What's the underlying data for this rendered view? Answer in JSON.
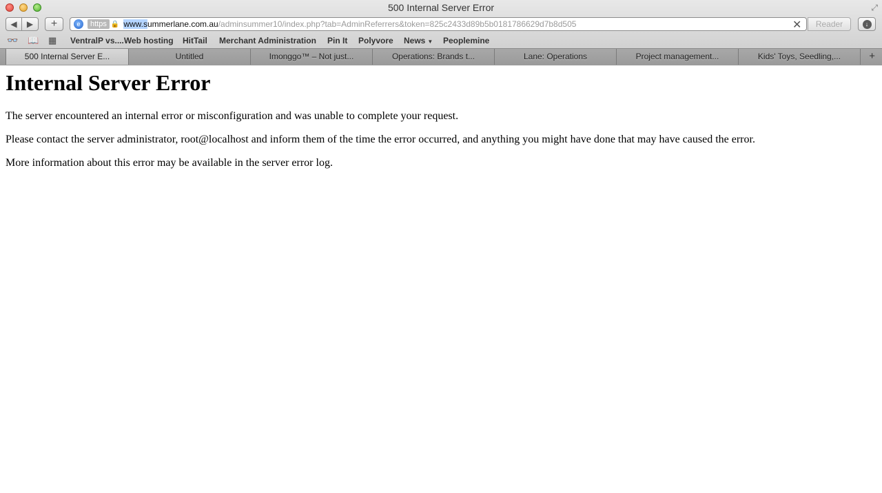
{
  "window": {
    "title": "500 Internal Server Error"
  },
  "toolbar": {
    "back_icon": "triangle-left-icon",
    "forward_icon": "triangle-right-icon",
    "new_tab_label": "+",
    "url": {
      "scheme_badge": "https",
      "host_selected": "www.s",
      "host_rest": "ummerlane.com.au",
      "path": "/adminsummer10/index.php?tab=AdminReferrers&token=825c2433d89b5b0181786629d7b8d505"
    },
    "reader_label": "Reader"
  },
  "bookmarks": {
    "items": [
      {
        "label": "VentralP vs....Web hosting"
      },
      {
        "label": "HitTail"
      },
      {
        "label": "Merchant Administration"
      },
      {
        "label": "Pin It"
      },
      {
        "label": "Polyvore"
      },
      {
        "label": "News"
      },
      {
        "label": "Peoplemine"
      }
    ]
  },
  "tabs": [
    {
      "label": "500 Internal Server E..."
    },
    {
      "label": "Untitled"
    },
    {
      "label": "Imonggo™ – Not just..."
    },
    {
      "label": "Operations: Brands t..."
    },
    {
      "label": "Lane: Operations"
    },
    {
      "label": "Project management..."
    },
    {
      "label": "Kids' Toys, Seedling,..."
    }
  ],
  "page": {
    "heading": "Internal Server Error",
    "p1": "The server encountered an internal error or misconfiguration and was unable to complete your request.",
    "p2": "Please contact the server administrator, root@localhost and inform them of the time the error occurred, and anything you might have done that may have caused the error.",
    "p3": "More information about this error may be available in the server error log."
  }
}
